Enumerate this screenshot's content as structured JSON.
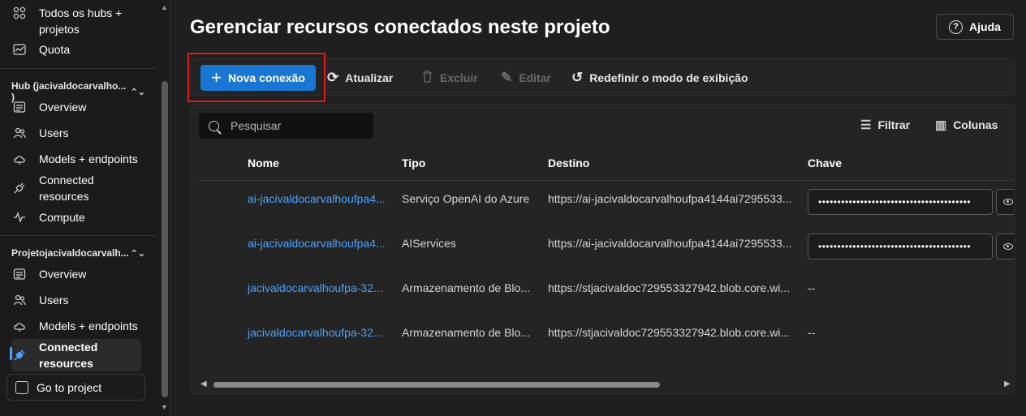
{
  "sidebar": {
    "top_items": [
      {
        "label": "Todos os hubs +\nprojetos",
        "icon": "grid-icon"
      },
      {
        "label": "Quota",
        "icon": "chart-icon"
      }
    ],
    "hub_group": {
      "label": "Hub (jacivaldocarvalho... )",
      "items": [
        {
          "label": "Overview",
          "icon": "overview-icon"
        },
        {
          "label": "Users",
          "icon": "users-icon"
        },
        {
          "label": "Models + endpoints",
          "icon": "cloud-icon"
        },
        {
          "label": "Connected\nresources",
          "icon": "plug-icon"
        },
        {
          "label": "Compute",
          "icon": "pulse-icon"
        }
      ]
    },
    "project_group": {
      "label": "Projetojacivaldocarvalh...",
      "items": [
        {
          "label": "Overview",
          "icon": "overview-icon"
        },
        {
          "label": "Users",
          "icon": "users-icon"
        },
        {
          "label": "Models + endpoints",
          "icon": "cloud-icon"
        },
        {
          "label": "Connected\nresources",
          "icon": "plug-icon",
          "active": true
        }
      ]
    },
    "go_to_project": "Go to project"
  },
  "header": {
    "title": "Gerenciar recursos conectados neste projeto",
    "help_label": "Ajuda"
  },
  "toolbar": {
    "new_connection": "Nova conexão",
    "refresh": "Atualizar",
    "delete": "Excluir",
    "edit": "Editar",
    "reset_view": "Redefinir o modo de exibição"
  },
  "table": {
    "search_placeholder": "Pesquisar",
    "filter_label": "Filtrar",
    "columns_label": "Colunas",
    "headers": {
      "name": "Nome",
      "type": "Tipo",
      "target": "Destino",
      "key": "Chave"
    },
    "rows": [
      {
        "name": "ai-jacivaldocarvalhoufpa4...",
        "type": "Serviço OpenAI do Azure",
        "target": "https://ai-jacivaldocarvalhoufpa4144ai7295533...",
        "key": "••••••••••••••••••••••••••••••••••••••••",
        "has_key": true
      },
      {
        "name": "ai-jacivaldocarvalhoufpa4...",
        "type": "AIServices",
        "target": "https://ai-jacivaldocarvalhoufpa4144ai7295533...",
        "key": "••••••••••••••••••••••••••••••••••••••••",
        "has_key": true
      },
      {
        "name": "jacivaldocarvalhoufpa-32...",
        "type": "Armazenamento de Blo...",
        "target": "https://stjacivaldoc729553327942.blob.core.wi...",
        "key": "--",
        "has_key": false
      },
      {
        "name": "jacivaldocarvalhoufpa-32...",
        "type": "Armazenamento de Blo...",
        "target": "https://stjacivaldoc729553327942.blob.core.wi...",
        "key": "--",
        "has_key": false
      }
    ]
  },
  "colors": {
    "accent": "#1976d2",
    "link": "#4aa3ff",
    "highlight": "#e11b1b"
  }
}
